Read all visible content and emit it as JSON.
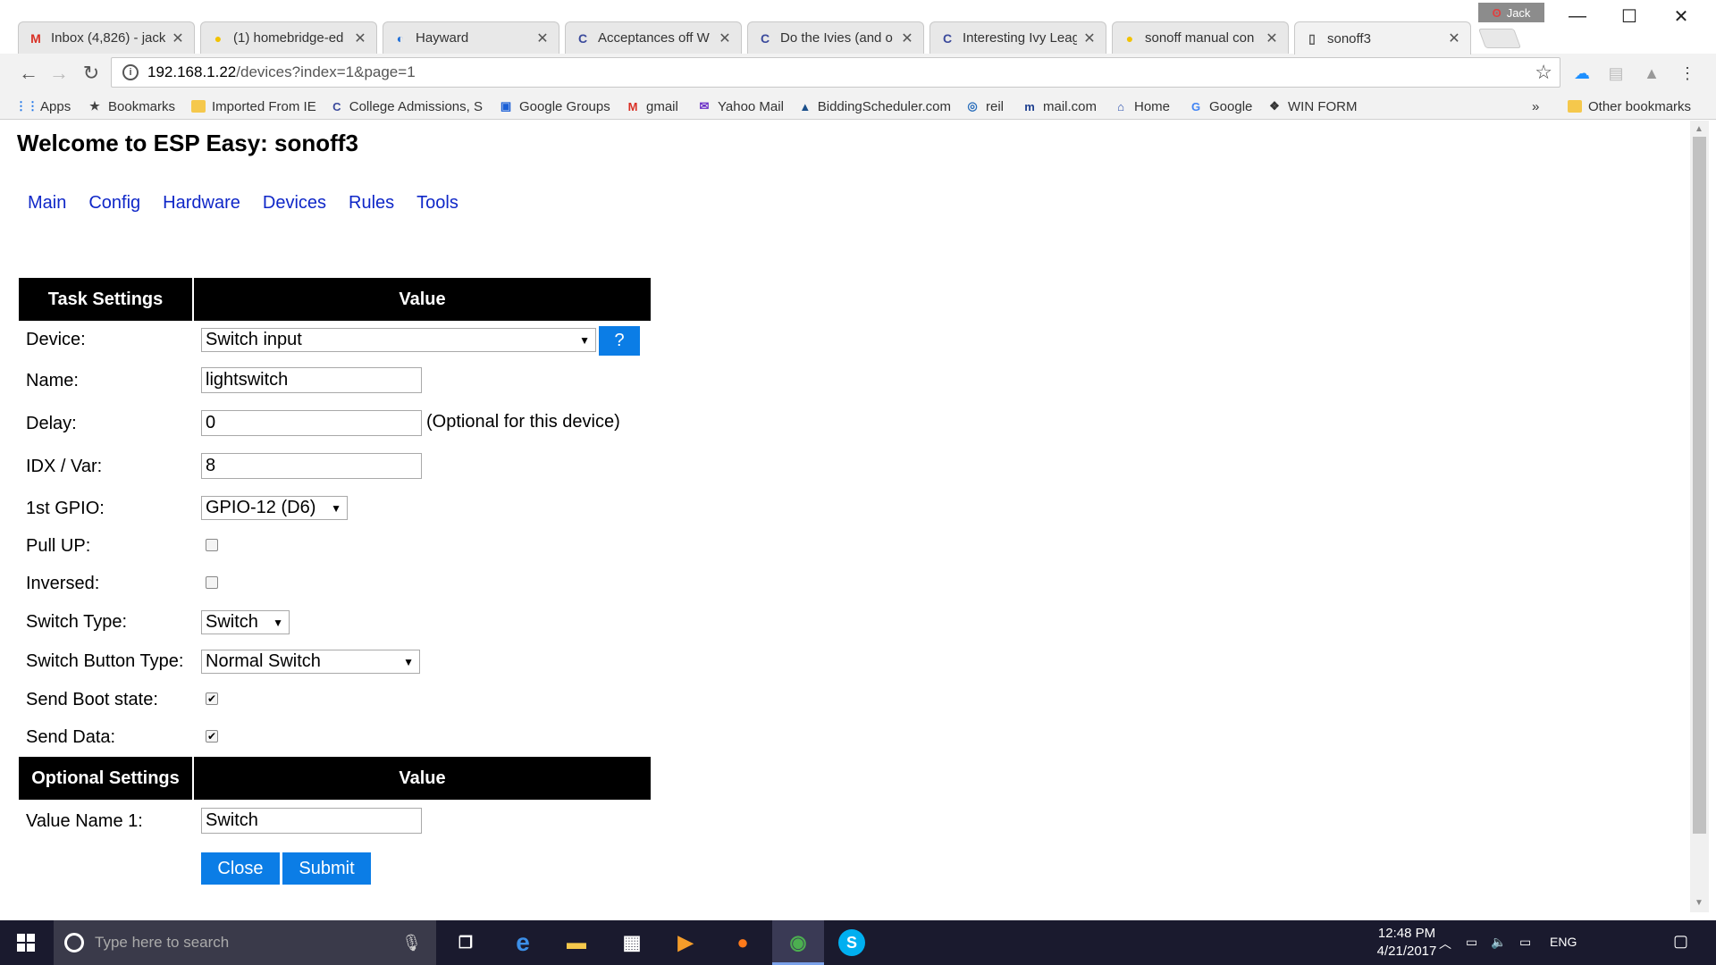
{
  "browser": {
    "tabs": [
      {
        "label": "Inbox (4,826) - jack",
        "icon": "gmail-icon",
        "glyph": "M",
        "color": "#d93025"
      },
      {
        "label": "(1) homebridge-ed",
        "icon": "lightbulb-icon",
        "glyph": "●",
        "color": "#f2c200"
      },
      {
        "label": "Hayward",
        "icon": "hayward-icon",
        "glyph": "◐",
        "color": "#1e6fd9"
      },
      {
        "label": "Acceptances off W",
        "icon": "collegeconfidential-icon",
        "glyph": "C",
        "color": "#3b4a9c"
      },
      {
        "label": "Do the Ivies (and o",
        "icon": "collegeconfidential-icon",
        "glyph": "C",
        "color": "#3b4a9c"
      },
      {
        "label": "Interesting Ivy Leag",
        "icon": "collegeconfidential-icon",
        "glyph": "C",
        "color": "#3b4a9c"
      },
      {
        "label": "sonoff manual con",
        "icon": "lightbulb-icon",
        "glyph": "●",
        "color": "#f2c200"
      },
      {
        "label": "sonoff3",
        "icon": "page-icon",
        "glyph": "▯",
        "color": "#555555"
      }
    ],
    "profile_name": "Jack",
    "url_host": "192.168.1.22",
    "url_path": "/devices?index=1&page=1",
    "bookmarks": [
      {
        "label": "Apps",
        "icon": "apps-grid-icon",
        "glyph": "⋮⋮",
        "color": "#1a73e8"
      },
      {
        "label": "Bookmarks",
        "icon": "star-icon",
        "glyph": "★",
        "color": "#444444"
      },
      {
        "label": "Imported From IE",
        "icon": "folder-icon",
        "glyph": "",
        "color": "#f5c84c"
      },
      {
        "label": "College Admissions, S",
        "icon": "collegeconfidential-icon",
        "glyph": "C",
        "color": "#3b4a9c"
      },
      {
        "label": "Google Groups",
        "icon": "google-groups-icon",
        "glyph": "▣",
        "color": "#1a5fd6"
      },
      {
        "label": "gmail",
        "icon": "gmail-icon",
        "glyph": "M",
        "color": "#d93025"
      },
      {
        "label": "Yahoo Mail",
        "icon": "yahoo-mail-icon",
        "glyph": "✉",
        "color": "#6b2fc7"
      },
      {
        "label": "BiddingScheduler.com",
        "icon": "bidding-icon",
        "glyph": "▲",
        "color": "#1b4f8a"
      },
      {
        "label": "reil",
        "icon": "reil-icon",
        "glyph": "◎",
        "color": "#2a6ebb"
      },
      {
        "label": "mail.com",
        "icon": "mailcom-icon",
        "glyph": "m",
        "color": "#1d3f8f"
      },
      {
        "label": "Home",
        "icon": "home-icon",
        "glyph": "⌂",
        "color": "#2a4fae"
      },
      {
        "label": "Google",
        "icon": "google-icon",
        "glyph": "G",
        "color": "#4285f4"
      },
      {
        "label": "WIN FORM",
        "icon": "winform-icon",
        "glyph": "❖",
        "color": "#333333"
      }
    ],
    "overflow": "»",
    "other_bookmarks": "Other bookmarks"
  },
  "page": {
    "heading": "Welcome to ESP Easy: sonoff3",
    "menu": [
      "Main",
      "Config",
      "Hardware",
      "Devices",
      "Rules",
      "Tools"
    ],
    "task_settings": {
      "col1": "Task Settings",
      "col2": "Value",
      "device_label": "Device:",
      "device_value": "Switch input",
      "help_label": "?",
      "name_label": "Name:",
      "name_value": "lightswitch",
      "delay_label": "Delay:",
      "delay_value": "0",
      "delay_note": "(Optional for this device)",
      "idx_label": "IDX / Var:",
      "idx_value": "8",
      "gpio_label": "1st GPIO:",
      "gpio_value": "GPIO-12 (D6)",
      "pullup_label": "Pull UP:",
      "pullup_checked": false,
      "inversed_label": "Inversed:",
      "inversed_checked": false,
      "switch_type_label": "Switch Type:",
      "switch_type_value": "Switch",
      "button_type_label": "Switch Button Type:",
      "button_type_value": "Normal Switch",
      "boot_label": "Send Boot state:",
      "boot_checked": true,
      "send_data_label": "Send Data:",
      "send_data_checked": true
    },
    "optional_settings": {
      "col1": "Optional Settings",
      "col2": "Value",
      "value_name_label": "Value Name 1:",
      "value_name_value": "Switch"
    },
    "close_label": "Close",
    "submit_label": "Submit"
  },
  "taskbar": {
    "search_placeholder": "Type here to search",
    "language": "ENG",
    "time": "12:48 PM",
    "date": "4/21/2017"
  },
  "colors": {
    "accent_blue": "#0b7de6",
    "link_blue": "#0f27c8",
    "header_black": "#000000"
  }
}
